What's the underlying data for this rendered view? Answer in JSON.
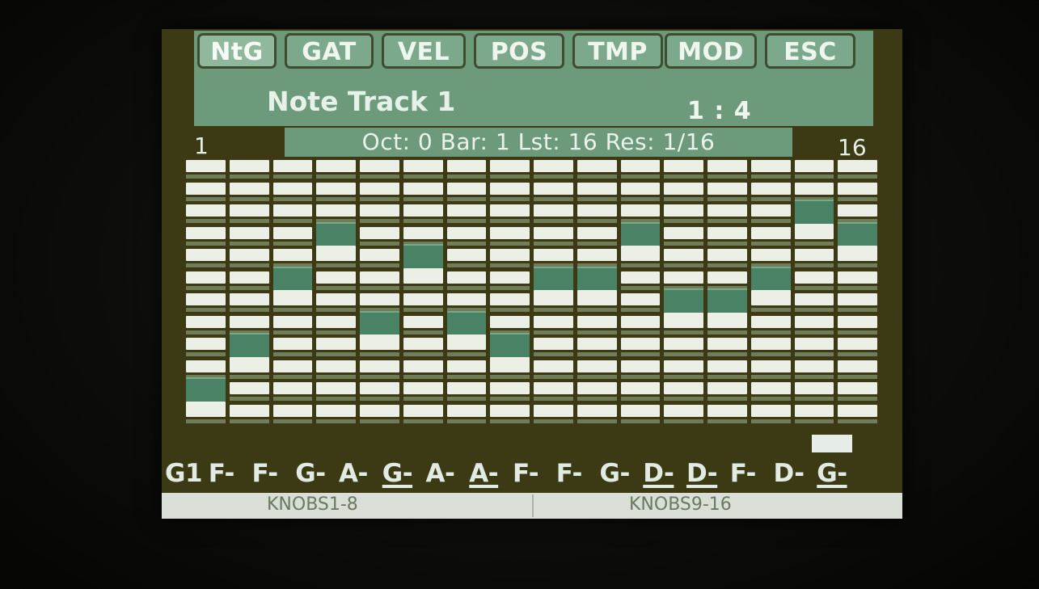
{
  "tabs": [
    {
      "label": "NtG",
      "active": true
    },
    {
      "label": "GAT",
      "active": false
    },
    {
      "label": "VEL",
      "active": false
    },
    {
      "label": "POS",
      "active": false
    },
    {
      "label": "TMP",
      "active": false
    },
    {
      "label": "MOD",
      "active": false
    },
    {
      "label": "ESC",
      "active": false
    }
  ],
  "track_title": "Note Track 1",
  "counter": "1 : 4",
  "step_first": "1",
  "step_last": "16",
  "info": {
    "text": "Oct: 0  Bar: 1  Lst:  16  Res: 1/16"
  },
  "grid": {
    "rows": 12,
    "columns": 16,
    "selected_rows": [
      10,
      8,
      5,
      3,
      7,
      4,
      7,
      8,
      5,
      5,
      3,
      6,
      6,
      5,
      2,
      3
    ]
  },
  "notes": [
    "G1",
    "F-",
    "F-",
    "G-",
    "A-",
    "G-",
    "A-",
    "A-",
    "F-",
    "F-",
    "G-",
    "D-",
    "D-",
    "F-",
    "D-",
    "G-"
  ],
  "notes_underlined": [
    false,
    false,
    false,
    false,
    false,
    true,
    false,
    true,
    false,
    false,
    false,
    true,
    true,
    false,
    false,
    true
  ],
  "knobs": {
    "left": "KNOBS1-8",
    "right": "KNOBS9-16"
  },
  "colors": {
    "panel": "#6e9a7c",
    "background": "#3c3a14",
    "cell": "#ecefe6",
    "selected": "#4a8266"
  }
}
